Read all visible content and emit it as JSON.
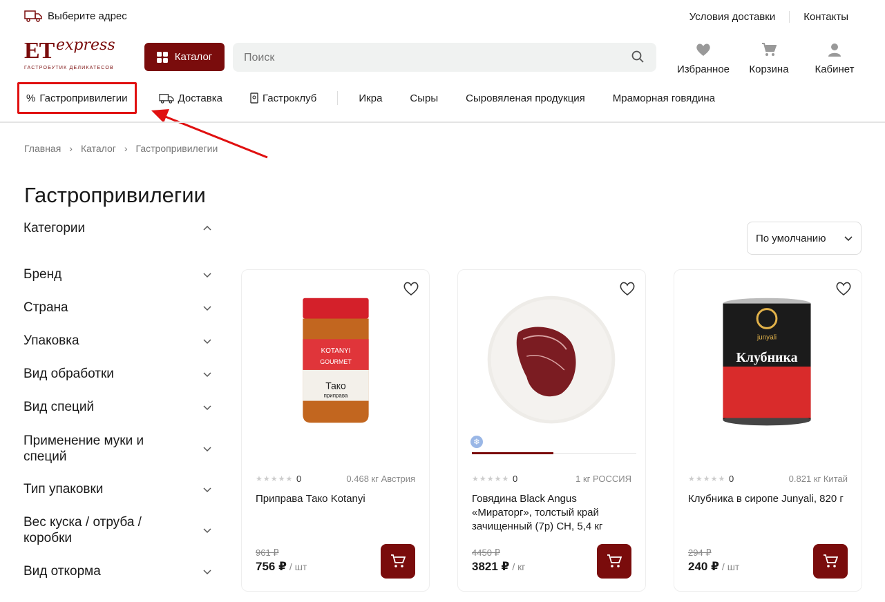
{
  "topbar": {
    "address": "Выберите адрес",
    "links": [
      "Условия доставки",
      "Контакты"
    ]
  },
  "logo": {
    "text": "ET",
    "sub": "express",
    "tagline": "ГАСТРОБУТИК ДЕЛИКАТЕСОВ"
  },
  "header": {
    "catalog_label": "Каталог",
    "search_placeholder": "Поиск",
    "icons": [
      {
        "name": "favorites",
        "label": "Избранное"
      },
      {
        "name": "cart",
        "label": "Корзина"
      },
      {
        "name": "account",
        "label": "Кабинет"
      }
    ]
  },
  "nav": {
    "highlight": "Гастропривилегии",
    "items": [
      "Доставка",
      "Гастроклуб"
    ],
    "categories": [
      "Икра",
      "Сыры",
      "Сыровяленая продукция",
      "Мраморная говядина"
    ]
  },
  "breadcrumb": [
    "Главная",
    "Каталог",
    "Гастропривилегии"
  ],
  "page_title": "Гастропривилегии",
  "sidebar": {
    "filters": [
      {
        "label": "Категории",
        "open": true
      },
      {
        "label": "Бренд"
      },
      {
        "label": "Страна"
      },
      {
        "label": "Упаковка"
      },
      {
        "label": "Вид обработки"
      },
      {
        "label": "Вид специй"
      },
      {
        "label": "Применение муки и специй"
      },
      {
        "label": "Тип упаковки"
      },
      {
        "label": "Вес куска / отруба / коробки"
      },
      {
        "label": "Вид откорма"
      }
    ]
  },
  "sort": {
    "selected": "По умолчанию"
  },
  "products": [
    {
      "rating": "0",
      "meta": "0.468 кг Австрия",
      "name": "Приправа Тако Kotanyi",
      "old_price": "961 ₽",
      "price": "756 ₽",
      "unit": "/ шт"
    },
    {
      "rating": "0",
      "meta": "1 кг РОССИЯ",
      "name": "Говядина Black Angus «Мираторг», толстый край зачищенный (7р) СН, 5,4 кг",
      "old_price": "4450 ₽",
      "price": "3821 ₽",
      "unit": "/ кг"
    },
    {
      "rating": "0",
      "meta": "0.821 кг Китай",
      "name": "Клубника в сиропе Junyali, 820 г",
      "old_price": "294 ₽",
      "price": "240 ₽",
      "unit": "/ шт"
    }
  ],
  "product_images": {
    "0": {
      "brand": "KOTANYI",
      "line": "GOURMET",
      "label": "Тако",
      "sub": "приправа"
    },
    "2": {
      "brand": "junyali",
      "label": "Клубника"
    }
  },
  "colors": {
    "brand": "#7a0c0c",
    "highlight": "#e01010"
  }
}
